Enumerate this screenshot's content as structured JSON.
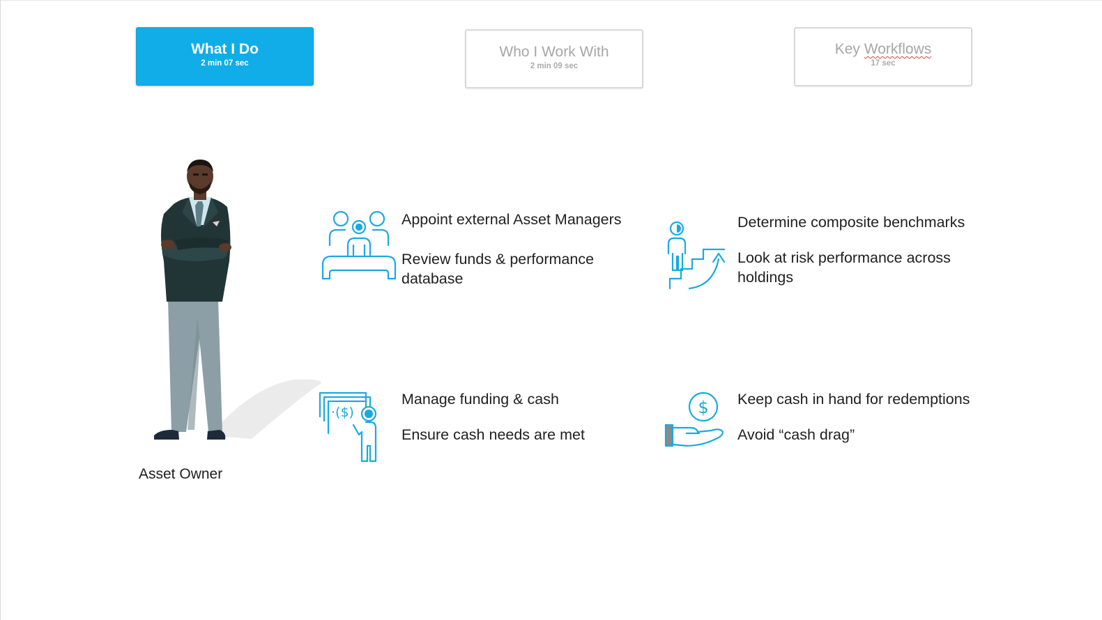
{
  "tabs": [
    {
      "title": "What I Do",
      "time": "2 min  07 sec",
      "state": "active"
    },
    {
      "title": "Who I Work With",
      "time": "2 min 09 sec",
      "state": "inactive"
    },
    {
      "title_plain": "Key ",
      "title_underlined": "Workflows",
      "time": "17 sec",
      "state": "inactive"
    }
  ],
  "role": {
    "label": "Asset Owner"
  },
  "activities": [
    {
      "icon": "meeting-board-icon",
      "lines": [
        "Appoint external Asset Managers",
        "Review funds & performance",
        "database"
      ]
    },
    {
      "icon": "climbing-stairs-icon",
      "lines": [
        "Determine composite benchmarks",
        "Look at risk performance across",
        "holdings"
      ]
    },
    {
      "icon": "cash-presentation-icon",
      "lines": [
        "Manage funding & cash",
        "Ensure cash needs are met"
      ]
    },
    {
      "icon": "hand-dollar-coin-icon",
      "lines": [
        "Keep cash in hand for redemptions",
        "Avoid “cash drag”"
      ]
    }
  ],
  "colors": {
    "accent": "#10ade8",
    "icon_stroke": "#19a9e1",
    "text": "#1f1f1f",
    "inactive_text": "#a6a6a6"
  }
}
